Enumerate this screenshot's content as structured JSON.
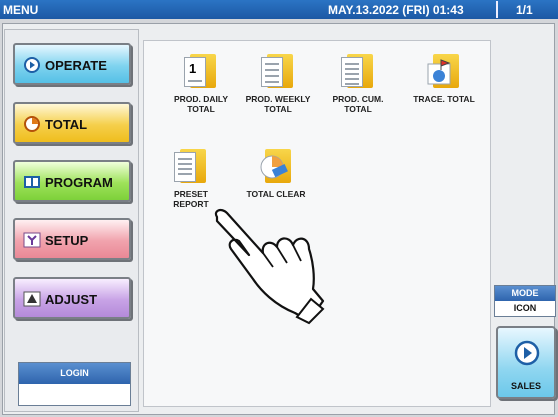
{
  "topbar": {
    "title": "MENU",
    "datetime": "MAY.13.2022 (FRI)  01:43",
    "page": "1/1"
  },
  "nav": {
    "operate": "OPERATE",
    "total": "TOTAL",
    "program": "PROGRAM",
    "setup": "SETUP",
    "adjust": "ADJUST"
  },
  "login": {
    "label": "LOGIN"
  },
  "tiles": [
    {
      "line1": "PROD. DAILY",
      "line2": "TOTAL"
    },
    {
      "line1": "PROD. WEEKLY",
      "line2": "TOTAL"
    },
    {
      "line1": "PROD. CUM.",
      "line2": "TOTAL"
    },
    {
      "line1": "TRACE. TOTAL",
      "line2": ""
    },
    {
      "line1": "PRESET",
      "line2": "REPORT"
    },
    {
      "line1": "TOTAL CLEAR",
      "line2": ""
    }
  ],
  "mode": {
    "label": "MODE",
    "value": "ICON"
  },
  "sales": {
    "label": "SALES"
  },
  "icons": {
    "operate": "play-icon",
    "total": "clock-icon",
    "program": "book-icon",
    "setup": "wrench-icon",
    "adjust": "adjust-icon",
    "sales": "play-circle-icon"
  }
}
